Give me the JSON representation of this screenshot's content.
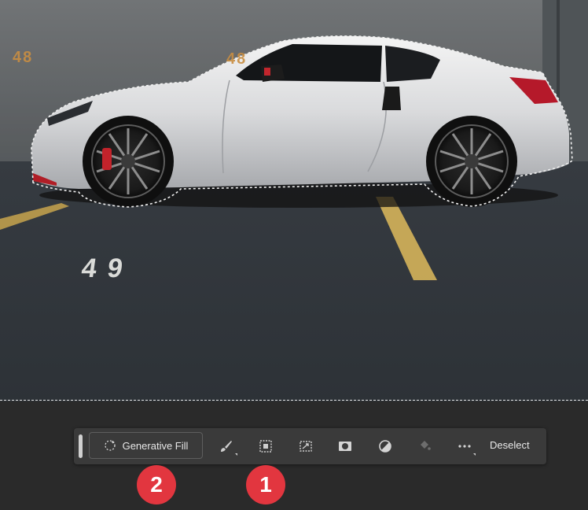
{
  "canvas": {
    "wall_number": "48",
    "wall_number_right": "48",
    "floor_number": "49"
  },
  "taskbar": {
    "generative_fill_label": "Generative Fill",
    "deselect_label": "Deselect",
    "tools": [
      "brush-icon",
      "transform-icon",
      "expand-icon",
      "mask-icon",
      "adjustment-icon",
      "fill-icon",
      "more-icon"
    ]
  },
  "annotations": {
    "badge_1": "1",
    "badge_2": "2",
    "color": "#e2363f"
  }
}
